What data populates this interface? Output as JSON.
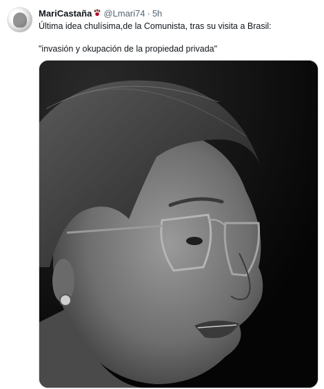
{
  "tweet": {
    "author_name": "MariCastaña",
    "author_handle": "@Lmari74",
    "separator": "·",
    "timestamp": "5h",
    "text_line1": "Última idea chulísima,de la Comunista, tras su visita a Brasil:",
    "text_line2": "\"invasión y okupación de la propiedad privada\"",
    "name_emoji": "paw-prints-icon"
  }
}
